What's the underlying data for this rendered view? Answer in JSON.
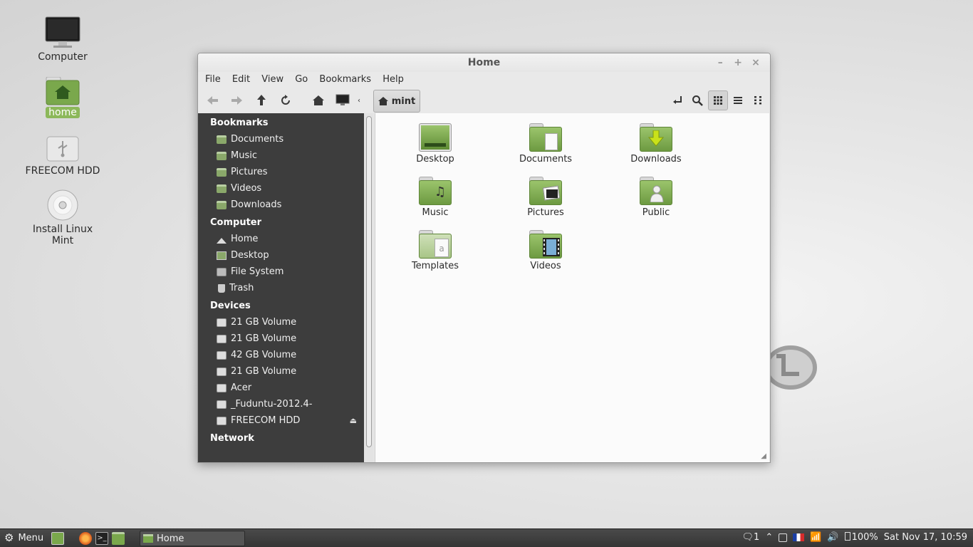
{
  "desktop": {
    "icons": [
      {
        "label": "Computer"
      },
      {
        "label": "home"
      },
      {
        "label": "FREECOM HDD"
      },
      {
        "label": "Install Linux Mint"
      }
    ]
  },
  "window": {
    "title": "Home",
    "controls": {
      "minimize": "–",
      "maximize": "+",
      "close": "×"
    },
    "menu": [
      "File",
      "Edit",
      "View",
      "Go",
      "Bookmarks",
      "Help"
    ],
    "path_button": "mint",
    "sidebar": {
      "bookmarks_title": "Bookmarks",
      "bookmarks": [
        "Documents",
        "Music",
        "Pictures",
        "Videos",
        "Downloads"
      ],
      "computer_title": "Computer",
      "computer": [
        "Home",
        "Desktop",
        "File System",
        "Trash"
      ],
      "devices_title": "Devices",
      "devices": [
        "21 GB Volume",
        "21 GB Volume",
        "42 GB Volume",
        "21 GB Volume",
        "Acer",
        "_Fuduntu-2012.4-",
        "FREECOM HDD"
      ],
      "network_title": "Network"
    },
    "files": [
      "Desktop",
      "Documents",
      "Downloads",
      "Music",
      "Pictures",
      "Public",
      "Templates",
      "Videos"
    ]
  },
  "panel": {
    "menu_label": "Menu",
    "task_label": "Home",
    "notifications": "1",
    "battery": "100%",
    "clock": "Sat Nov 17, 10:59"
  },
  "colors": {
    "accent": "#8cb85a",
    "sidebar": "#3d3d3d",
    "panel": "#3f3f3f"
  }
}
